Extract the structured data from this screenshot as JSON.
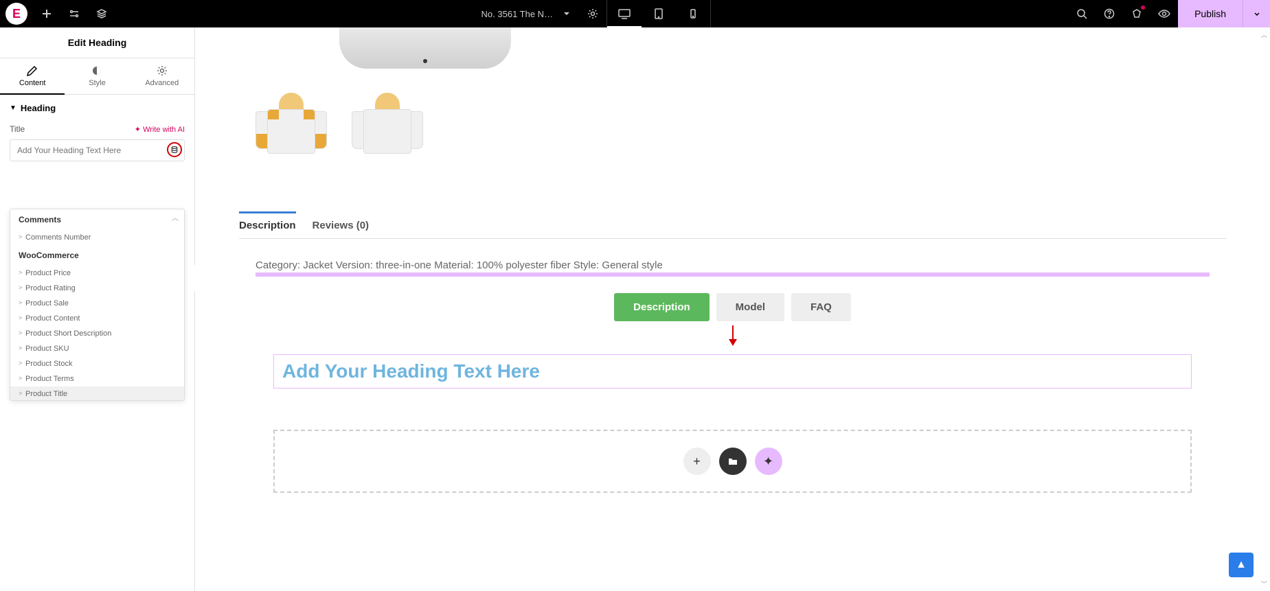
{
  "topbar": {
    "logo": "E",
    "page_name": "No. 3561 The No…",
    "publish": "Publish"
  },
  "panel": {
    "title": "Edit Heading",
    "tabs": {
      "content": "Content",
      "style": "Style",
      "advanced": "Advanced"
    },
    "section": "Heading",
    "title_label": "Title",
    "write_ai": "✦ Write with AI",
    "title_placeholder": "Add Your Heading Text Here"
  },
  "dropdown": {
    "group_comments": "Comments",
    "item_comments_number": "Comments Number",
    "group_woo": "WooCommerce",
    "items": {
      "price": "Product Price",
      "rating": "Product Rating",
      "sale": "Product Sale",
      "content": "Product Content",
      "short_desc": "Product Short Description",
      "sku": "Product SKU",
      "stock": "Product Stock",
      "terms": "Product Terms",
      "title": "Product Title"
    }
  },
  "canvas": {
    "woo_tabs": {
      "desc": "Description",
      "reviews": "Reviews (0)"
    },
    "desc_text": "Category: Jacket Version: three-in-one Material: 100% polyester fiber Style: General style",
    "inner_tabs": {
      "desc": "Description",
      "model": "Model",
      "faq": "FAQ"
    },
    "heading": "Add Your Heading Text Here",
    "add_plus": "+",
    "add_folder": "📁",
    "add_ai": "✦"
  },
  "scroll_top": "▲"
}
